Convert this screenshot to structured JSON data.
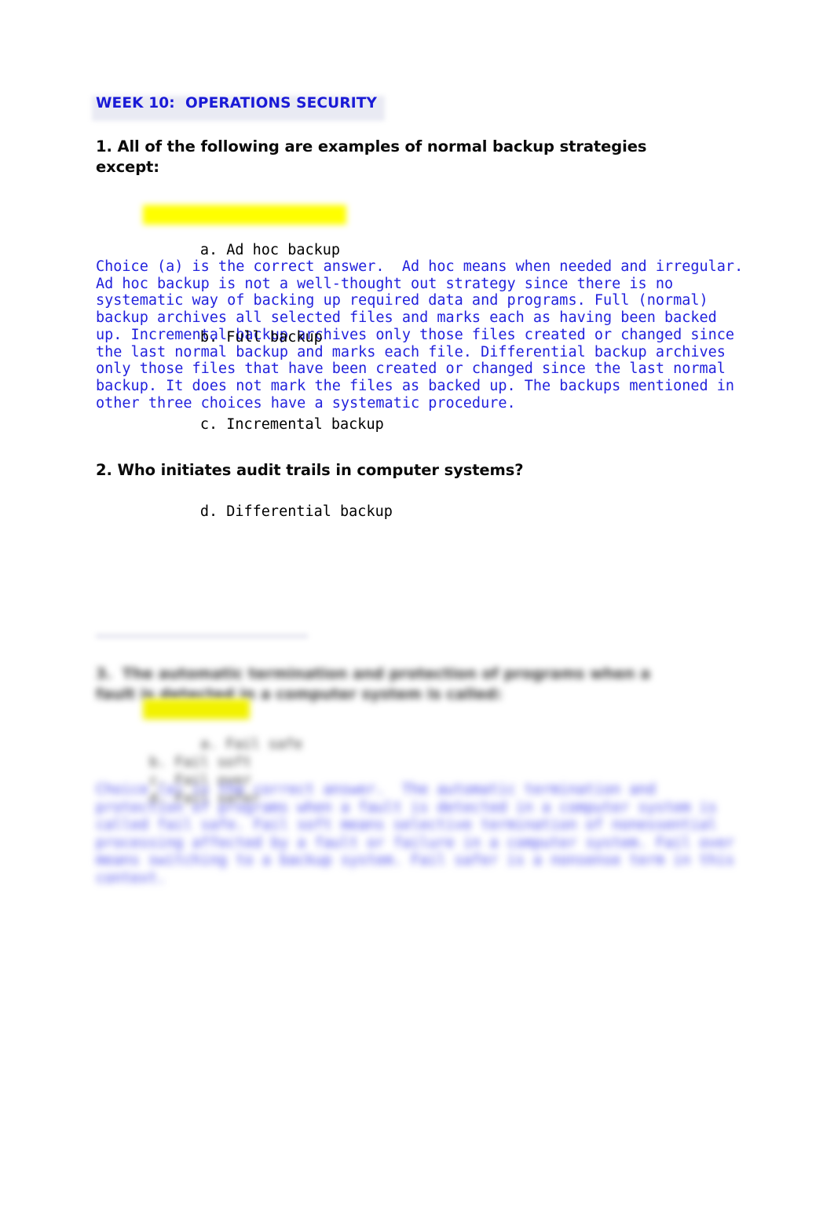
{
  "document": {
    "title": "WEEK 10:  OPERATIONS SECURITY",
    "title_color": "#1a1ad6",
    "title_highlight_color": "#e9eaf3",
    "body_text_color": "#000000",
    "answer_text_color": "#2222dd",
    "highlight_color": "#ffff00",
    "background_color": "#ffffff"
  },
  "questions": [
    {
      "number": "1.",
      "prompt": "1.  All of the following are examples of normal backup strategies except:",
      "choices": [
        {
          "label": "a. Ad hoc backup",
          "highlighted": true
        },
        {
          "label": "b. Full backup",
          "highlighted": false
        },
        {
          "label": "c. Incremental backup",
          "highlighted": false
        },
        {
          "label": "d. Differential backup",
          "highlighted": false
        }
      ],
      "explanation": "Choice (a) is the correct answer.  Ad hoc means when needed and irregular.  Ad hoc backup is not a well-thought out strategy since there is no systematic way of backing up required data and programs. Full (normal) backup archives all selected files and marks each as having been backed up. Incremental backup archives only those files created or changed since the last normal backup and marks each file. Differential backup archives only those files that have been created or changed since the last normal backup. It does not mark the files as backed up. The backups mentioned in other three choices have a systematic procedure."
    },
    {
      "number": "2.",
      "prompt": "2.  Who initiates audit trails in computer systems?",
      "choices": [],
      "explanation": ""
    }
  ],
  "obscured_section": {
    "note": "blurred / illegible region of the page",
    "rule_visible": true,
    "question_placeholder": "3.  The automatic termination and protection of programs when a fault is detected in a computer system is called:",
    "choices_placeholder": "a. Fail safe\nb. Fail soft\nc. Fail over\nd. Fail safer",
    "explanation_placeholder": "Choice (a) is the correct answer.  The automatic termination and protection of programs when a fault is detected in a computer system is called fail safe. Fail soft means selective termination of nonessential processing affected by a fault or failure in a computer system. Fail over means switching to a backup system. Fail safer is a nonsense term in this context."
  }
}
